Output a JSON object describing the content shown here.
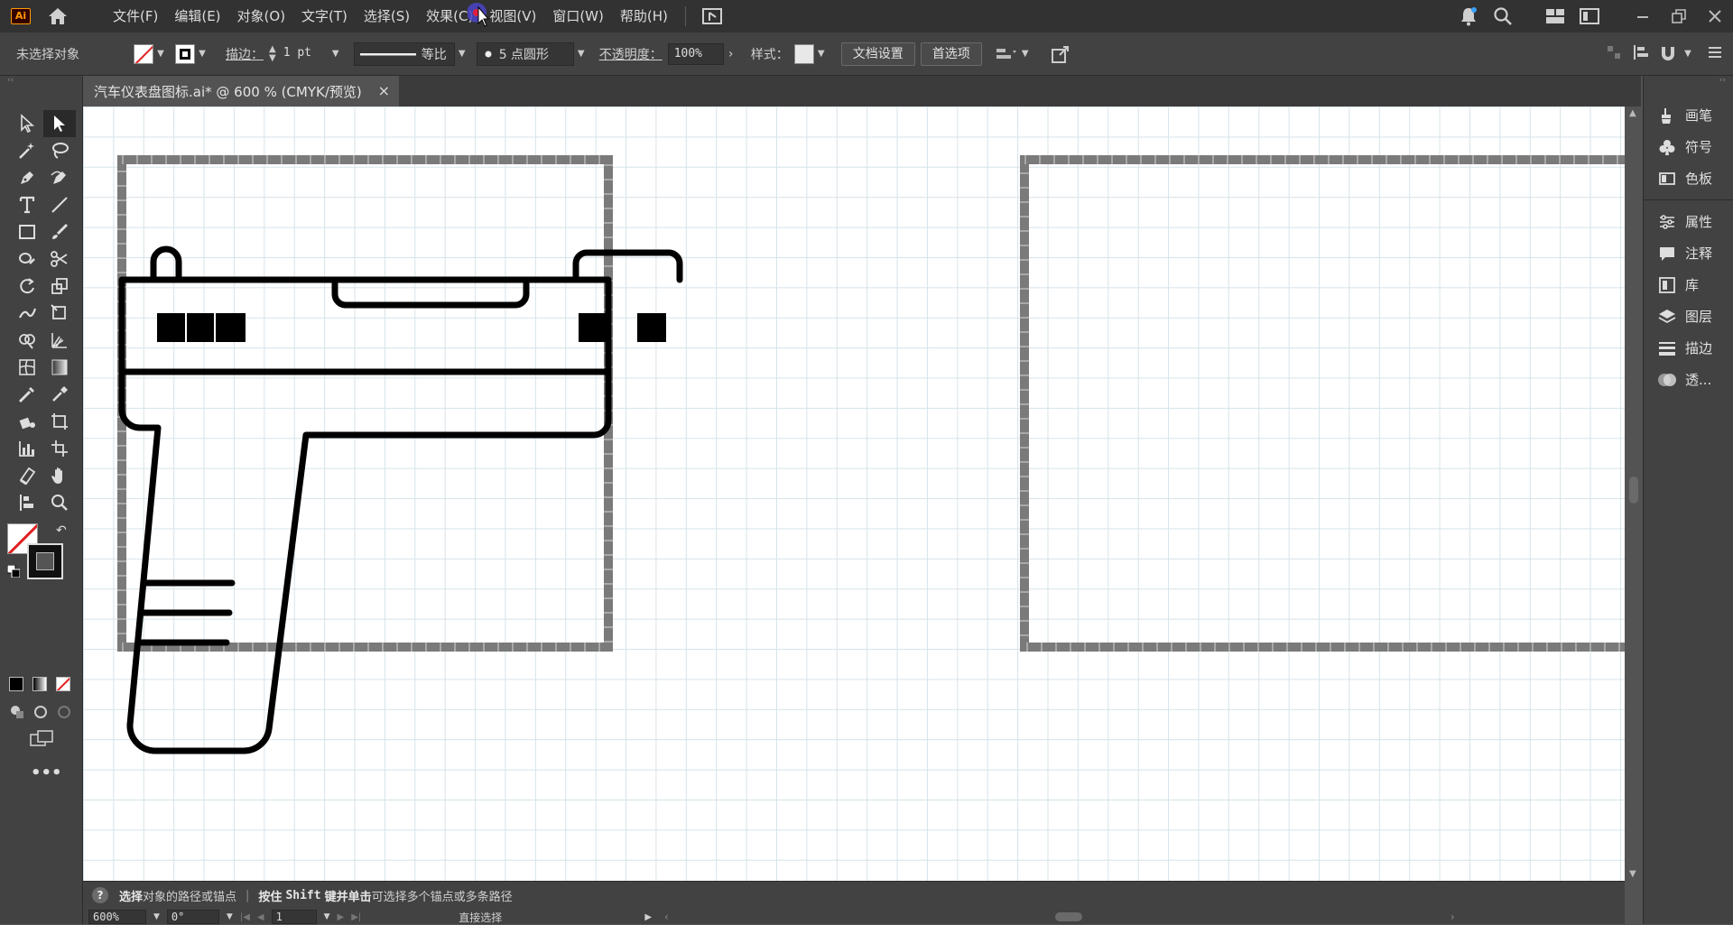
{
  "app": {
    "logo": "Ai"
  },
  "menu": [
    "文件(F)",
    "编辑(E)",
    "对象(O)",
    "文字(T)",
    "选择(S)",
    "效果(C)",
    "视图(V)",
    "窗口(W)",
    "帮助(H)"
  ],
  "control": {
    "selection_label": "未选择对象",
    "stroke_label": "描边：",
    "stroke_value": "1 pt",
    "profile_label": "等比",
    "brush_label": "5 点圆形",
    "opacity_label": "不透明度：",
    "opacity_value": "100%",
    "style_label": "样式：",
    "doc_settings": "文档设置",
    "preferences": "首选项"
  },
  "document_tab": {
    "title": "汽车仪表盘图标.ai* @ 600 % (CMYK/预览)",
    "close": "×"
  },
  "right_panel": [
    {
      "label": "画笔",
      "icon": "brush-icon"
    },
    {
      "label": "符号",
      "icon": "club-icon"
    },
    {
      "label": "色板",
      "icon": "swatches-icon"
    },
    {
      "label": "属性",
      "icon": "sliders-icon"
    },
    {
      "label": "注释",
      "icon": "comment-icon"
    },
    {
      "label": "库",
      "icon": "library-icon"
    },
    {
      "label": "图层",
      "icon": "layers-icon"
    },
    {
      "label": "描边",
      "icon": "stroke-icon"
    },
    {
      "label": "透...",
      "icon": "transparency-icon"
    }
  ],
  "status": {
    "help": "?",
    "msg_bold": "选择",
    "msg1": "对象的路径或锚点",
    "msg2_prefix": "按住",
    "msg2_key": "Shift",
    "msg2_mid": "键并单击",
    "msg2_rest": "可选择多个锚点或多条路径",
    "zoom": "600%",
    "rotation": "0°",
    "artboard": "1",
    "tool_name": "直接选择"
  },
  "colors": {
    "menubar": "#323232",
    "panel": "#424242",
    "workspace": "#535353",
    "canvas": "#ffffff",
    "grid": "#d6e3ea",
    "artboard_border": "#7a7a7a"
  }
}
